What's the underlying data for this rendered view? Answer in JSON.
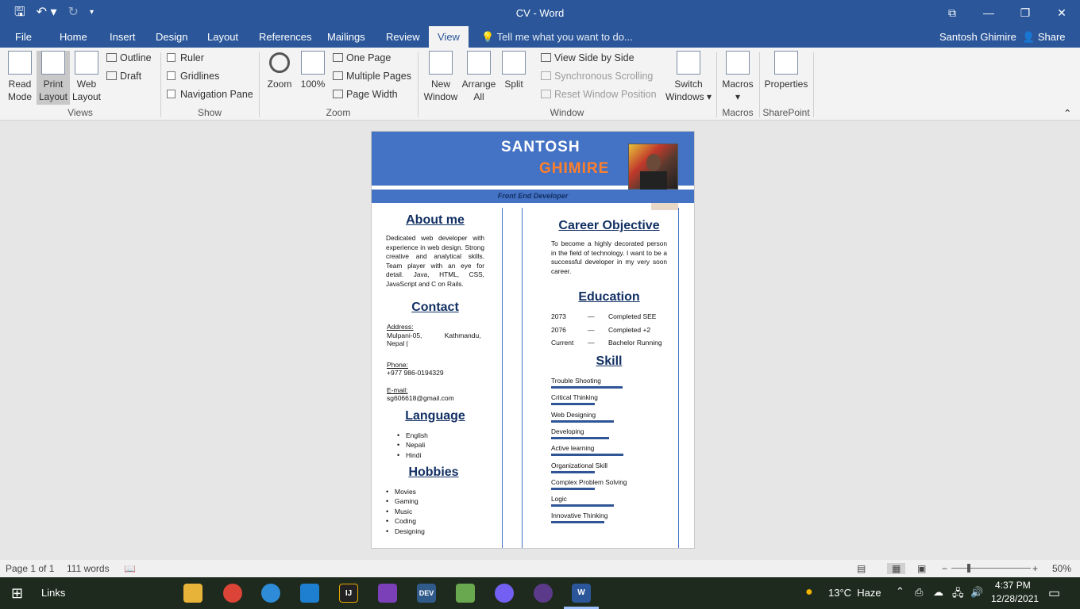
{
  "window": {
    "title": "CV - Word"
  },
  "menu": {
    "tabs": [
      "File",
      "Home",
      "Insert",
      "Design",
      "Layout",
      "References",
      "Mailings",
      "Review",
      "View"
    ],
    "active": "View",
    "tell_me": "Tell me what you want to do...",
    "user": "Santosh Ghimire",
    "share": "Share"
  },
  "ribbon": {
    "views": {
      "read_mode": [
        "Read",
        "Mode"
      ],
      "print_layout": [
        "Print",
        "Layout"
      ],
      "web_layout": [
        "Web",
        "Layout"
      ],
      "outline": "Outline",
      "draft": "Draft",
      "group": "Views"
    },
    "show": {
      "ruler": "Ruler",
      "gridlines": "Gridlines",
      "navigation_pane": "Navigation Pane",
      "group": "Show"
    },
    "zoom": {
      "zoom": "Zoom",
      "hundred": "100%",
      "one_page": "One Page",
      "multiple_pages": "Multiple Pages",
      "page_width": "Page Width",
      "group": "Zoom"
    },
    "window": {
      "new_window": [
        "New",
        "Window"
      ],
      "arrange_all": [
        "Arrange",
        "All"
      ],
      "split": "Split",
      "side_by_side": "View Side by Side",
      "sync_scroll": "Synchronous Scrolling",
      "reset_pos": "Reset Window Position",
      "switch": [
        "Switch",
        "Windows"
      ],
      "group": "Window"
    },
    "macros": {
      "macros": "Macros",
      "group": "Macros"
    },
    "sharepoint": {
      "properties": "Properties",
      "group": "SharePoint"
    }
  },
  "cv": {
    "first_name": "SANTOSH",
    "last_name": "GHIMIRE",
    "role": "Front End Developer",
    "about_title": "About me",
    "about_text": "Dedicated web developer with experience in web design. Strong creative and analytical skills. Team player with an eye for detail. Java, HTML, CSS, JavaScript and C on Rails.",
    "contact_title": "Contact",
    "address_label": "Address:",
    "address_line1": "Mulpani-05,            Kathmandu,",
    "address_line2": "Nepal |",
    "phone_label": "Phone:",
    "phone": "+977 986-0194329",
    "email_label": "E-mail:",
    "email": "sg606618@gmail.com",
    "language_title": "Language",
    "languages": [
      "English",
      "Nepali",
      "Hindi"
    ],
    "hobbies_title": "Hobbies",
    "hobbies": [
      "Movies",
      "Gaming",
      "Music",
      "Coding",
      "Designing"
    ],
    "career_title": "Career Objective",
    "career_text": "To become a highly decorated person in the field of technology. I want to be a successful developer in my very soon career.",
    "education_title": "Education",
    "education": [
      {
        "year": "2073",
        "dash": "—",
        "text": "Completed SEE"
      },
      {
        "year": "2076",
        "dash": "—",
        "text": "Completed +2"
      },
      {
        "year": "Current",
        "dash": "—",
        "text": "Bachelor Running"
      }
    ],
    "skill_title": "Skill",
    "skills": [
      {
        "name": "Trouble Shooting",
        "level": 0.75
      },
      {
        "name": "Critical Thinking",
        "level": 0.46
      },
      {
        "name": "Web Designing",
        "level": 0.66
      },
      {
        "name": "Developing",
        "level": 0.61
      },
      {
        "name": "Active learning",
        "level": 0.76
      },
      {
        "name": "Organizational Skill",
        "level": 0.46
      },
      {
        "name": "Complex Problem Solving",
        "level": 0.46
      },
      {
        "name": "Logic",
        "level": 0.66
      },
      {
        "name": "Innovative Thinking",
        "level": 0.56
      }
    ]
  },
  "status": {
    "page": "Page 1 of 1",
    "words": "111 words",
    "zoom": "50%"
  },
  "taskbar": {
    "links": "Links",
    "weather": "13°C  Haze",
    "time": "4:37 PM",
    "date": "12/28/2021"
  }
}
